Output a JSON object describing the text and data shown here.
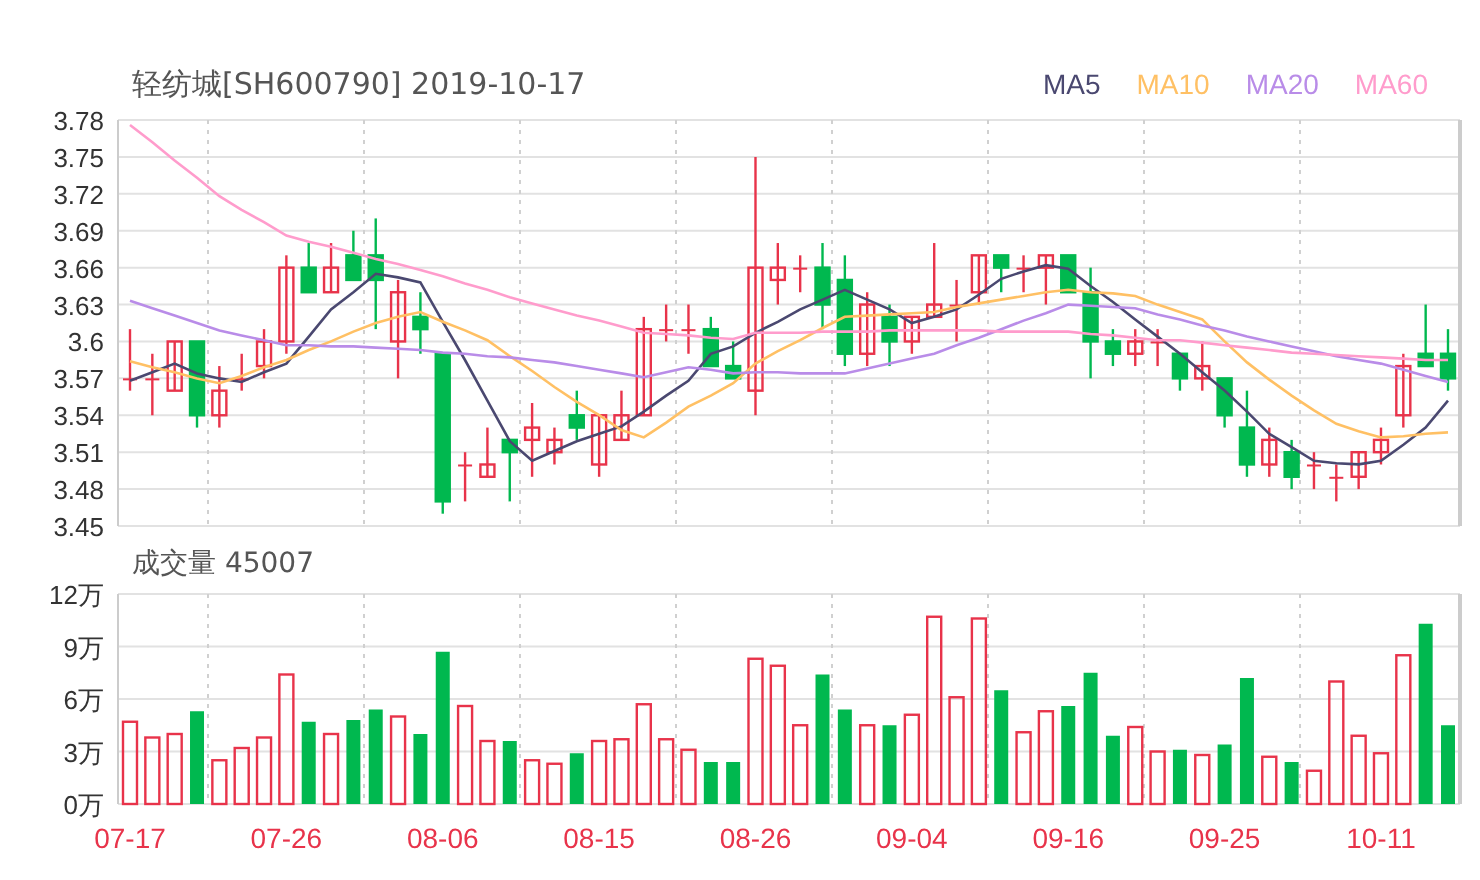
{
  "price_panel": {
    "chart_data": {
      "type": "candlestick",
      "title": "轻纺城[SH600790] 2019-10-17",
      "grid": true,
      "ylim": [
        3.45,
        3.78
      ],
      "yticks": [
        3.78,
        3.75,
        3.72,
        3.69,
        3.66,
        3.63,
        3.6,
        3.57,
        3.54,
        3.51,
        3.48,
        3.45
      ],
      "ohlc": [
        [
          3.57,
          3.61,
          3.56,
          3.57
        ],
        [
          3.57,
          3.59,
          3.54,
          3.57
        ],
        [
          3.56,
          3.6,
          3.56,
          3.6
        ],
        [
          3.6,
          3.6,
          3.53,
          3.54
        ],
        [
          3.54,
          3.58,
          3.53,
          3.56
        ],
        [
          3.57,
          3.59,
          3.56,
          3.57
        ],
        [
          3.58,
          3.61,
          3.57,
          3.6
        ],
        [
          3.6,
          3.67,
          3.59,
          3.66
        ],
        [
          3.66,
          3.68,
          3.64,
          3.64
        ],
        [
          3.64,
          3.68,
          3.64,
          3.66
        ],
        [
          3.67,
          3.69,
          3.65,
          3.65
        ],
        [
          3.67,
          3.7,
          3.61,
          3.65
        ],
        [
          3.6,
          3.65,
          3.57,
          3.64
        ],
        [
          3.62,
          3.64,
          3.59,
          3.61
        ],
        [
          3.59,
          3.59,
          3.46,
          3.47
        ],
        [
          3.5,
          3.51,
          3.47,
          3.5
        ],
        [
          3.49,
          3.53,
          3.49,
          3.5
        ],
        [
          3.52,
          3.52,
          3.47,
          3.51
        ],
        [
          3.52,
          3.55,
          3.49,
          3.53
        ],
        [
          3.51,
          3.53,
          3.5,
          3.52
        ],
        [
          3.54,
          3.56,
          3.52,
          3.53
        ],
        [
          3.5,
          3.54,
          3.49,
          3.54
        ],
        [
          3.52,
          3.56,
          3.52,
          3.54
        ],
        [
          3.54,
          3.62,
          3.54,
          3.61
        ],
        [
          3.61,
          3.63,
          3.6,
          3.61
        ],
        [
          3.61,
          3.63,
          3.59,
          3.61
        ],
        [
          3.61,
          3.62,
          3.58,
          3.58
        ],
        [
          3.58,
          3.6,
          3.57,
          3.57
        ],
        [
          3.56,
          3.75,
          3.54,
          3.66
        ],
        [
          3.65,
          3.68,
          3.63,
          3.66
        ],
        [
          3.66,
          3.67,
          3.64,
          3.66
        ],
        [
          3.66,
          3.68,
          3.61,
          3.63
        ],
        [
          3.65,
          3.67,
          3.58,
          3.59
        ],
        [
          3.59,
          3.64,
          3.58,
          3.63
        ],
        [
          3.62,
          3.63,
          3.58,
          3.6
        ],
        [
          3.6,
          3.62,
          3.59,
          3.62
        ],
        [
          3.62,
          3.68,
          3.62,
          3.63
        ],
        [
          3.63,
          3.65,
          3.6,
          3.63
        ],
        [
          3.64,
          3.67,
          3.63,
          3.67
        ],
        [
          3.67,
          3.67,
          3.64,
          3.66
        ],
        [
          3.66,
          3.67,
          3.64,
          3.66
        ],
        [
          3.66,
          3.67,
          3.63,
          3.67
        ],
        [
          3.67,
          3.67,
          3.64,
          3.64
        ],
        [
          3.64,
          3.66,
          3.57,
          3.6
        ],
        [
          3.6,
          3.61,
          3.58,
          3.59
        ],
        [
          3.59,
          3.61,
          3.58,
          3.6
        ],
        [
          3.6,
          3.61,
          3.58,
          3.6
        ],
        [
          3.59,
          3.59,
          3.56,
          3.57
        ],
        [
          3.57,
          3.6,
          3.56,
          3.58
        ],
        [
          3.57,
          3.57,
          3.53,
          3.54
        ],
        [
          3.53,
          3.56,
          3.49,
          3.5
        ],
        [
          3.5,
          3.53,
          3.49,
          3.52
        ],
        [
          3.51,
          3.52,
          3.48,
          3.49
        ],
        [
          3.5,
          3.51,
          3.48,
          3.5
        ],
        [
          3.49,
          3.5,
          3.47,
          3.49
        ],
        [
          3.49,
          3.51,
          3.48,
          3.51
        ],
        [
          3.51,
          3.53,
          3.5,
          3.52
        ],
        [
          3.54,
          3.59,
          3.53,
          3.58
        ],
        [
          3.59,
          3.63,
          3.58,
          3.58
        ],
        [
          3.59,
          3.61,
          3.56,
          3.57
        ]
      ]
    },
    "moving_averages": {
      "chart_data": {
        "type": "line",
        "ylim": [
          3.45,
          3.78
        ],
        "series": [
          {
            "name": "MA5",
            "color": "#4a4870",
            "values": [
              3.568,
              3.575,
              3.582,
              3.574,
              3.57,
              3.567,
              3.575,
              3.582,
              3.604,
              3.626,
              3.64,
              3.655,
              3.652,
              3.648,
              3.616,
              3.585,
              3.552,
              3.519,
              3.503,
              3.511,
              3.519,
              3.525,
              3.531,
              3.543,
              3.556,
              3.568,
              3.59,
              3.596,
              3.607,
              3.616,
              3.626,
              3.634,
              3.642,
              3.634,
              3.626,
              3.615,
              3.62,
              3.626,
              3.638,
              3.651,
              3.657,
              3.662,
              3.659,
              3.645,
              3.632,
              3.618,
              3.604,
              3.59,
              3.575,
              3.56,
              3.543,
              3.525,
              3.514,
              3.503,
              3.501,
              3.5,
              3.503,
              3.516,
              3.53,
              3.552
            ]
          },
          {
            "name": "MA10",
            "color": "#ffc064",
            "values": [
              3.584,
              3.579,
              3.575,
              3.57,
              3.566,
              3.572,
              3.579,
              3.585,
              3.593,
              3.6,
              3.608,
              3.615,
              3.62,
              3.624,
              3.616,
              3.609,
              3.601,
              3.588,
              3.576,
              3.563,
              3.551,
              3.54,
              3.528,
              3.522,
              3.534,
              3.547,
              3.556,
              3.566,
              3.582,
              3.592,
              3.601,
              3.611,
              3.62,
              3.621,
              3.622,
              3.623,
              3.624,
              3.628,
              3.631,
              3.634,
              3.637,
              3.64,
              3.642,
              3.64,
              3.639,
              3.637,
              3.63,
              3.624,
              3.618,
              3.6,
              3.583,
              3.569,
              3.556,
              3.544,
              3.533,
              3.527,
              3.522,
              3.523,
              3.525,
              3.526
            ]
          },
          {
            "name": "MA20",
            "color": "#b98ce8",
            "values": [
              3.633,
              3.627,
              3.621,
              3.615,
              3.609,
              3.605,
              3.601,
              3.597,
              3.597,
              3.596,
              3.596,
              3.595,
              3.594,
              3.593,
              3.591,
              3.59,
              3.588,
              3.587,
              3.585,
              3.583,
              3.58,
              3.577,
              3.574,
              3.571,
              3.575,
              3.579,
              3.577,
              3.574,
              3.575,
              3.575,
              3.574,
              3.574,
              3.574,
              3.578,
              3.582,
              3.586,
              3.59,
              3.597,
              3.603,
              3.61,
              3.617,
              3.623,
              3.63,
              3.629,
              3.628,
              3.627,
              3.622,
              3.618,
              3.613,
              3.609,
              3.604,
              3.6,
              3.596,
              3.592,
              3.588,
              3.585,
              3.582,
              3.577,
              3.572,
              3.567
            ]
          },
          {
            "name": "MA60",
            "color": "#ff9ccc",
            "values": [
              3.776,
              3.762,
              3.747,
              3.733,
              3.718,
              3.707,
              3.697,
              3.686,
              3.681,
              3.677,
              3.672,
              3.667,
              3.663,
              3.658,
              3.653,
              3.647,
              3.642,
              3.636,
              3.631,
              3.626,
              3.621,
              3.617,
              3.612,
              3.607,
              3.606,
              3.605,
              3.603,
              3.602,
              3.607,
              3.607,
              3.607,
              3.608,
              3.608,
              3.608,
              3.609,
              3.609,
              3.609,
              3.609,
              3.609,
              3.608,
              3.608,
              3.608,
              3.608,
              3.606,
              3.605,
              3.603,
              3.601,
              3.601,
              3.599,
              3.597,
              3.595,
              3.593,
              3.591,
              3.59,
              3.589,
              3.588,
              3.587,
              3.586,
              3.585,
              3.585
            ]
          }
        ]
      }
    }
  },
  "volume_panel": {
    "chart_data": {
      "type": "bar",
      "title": "成交量 45007",
      "grid": true,
      "ylim": [
        0,
        12
      ],
      "yticks": [
        {
          "value": 12,
          "label": "12万"
        },
        {
          "value": 9,
          "label": "9万"
        },
        {
          "value": 6,
          "label": "6万"
        },
        {
          "value": 3,
          "label": "3万"
        },
        {
          "value": 0,
          "label": "0万"
        }
      ],
      "categories": [
        "07-17",
        null,
        null,
        null,
        null,
        null,
        null,
        "07-26",
        null,
        null,
        null,
        null,
        null,
        null,
        "08-06",
        null,
        null,
        null,
        null,
        null,
        null,
        "08-15",
        null,
        null,
        null,
        null,
        null,
        null,
        "08-26",
        null,
        null,
        null,
        null,
        null,
        null,
        "09-04",
        null,
        null,
        null,
        null,
        null,
        null,
        "09-16",
        null,
        null,
        null,
        null,
        null,
        null,
        "09-25",
        null,
        null,
        null,
        null,
        null,
        null,
        "10-11",
        null,
        null,
        null
      ],
      "values": [
        4.7,
        3.8,
        4.0,
        5.3,
        2.5,
        3.2,
        3.8,
        7.4,
        4.7,
        4.0,
        4.8,
        5.4,
        5.0,
        4.0,
        8.7,
        5.6,
        3.6,
        3.6,
        2.5,
        2.3,
        2.9,
        3.6,
        3.7,
        5.7,
        3.7,
        3.1,
        2.4,
        2.4,
        8.3,
        7.9,
        4.5,
        7.4,
        5.4,
        4.5,
        4.5,
        5.1,
        10.7,
        6.1,
        10.6,
        6.5,
        4.1,
        5.3,
        5.6,
        7.5,
        3.9,
        4.4,
        3.0,
        3.1,
        2.8,
        3.4,
        7.2,
        2.7,
        2.4,
        1.9,
        7.0,
        3.9,
        2.9,
        8.5,
        10.3,
        4.5
      ]
    }
  }
}
